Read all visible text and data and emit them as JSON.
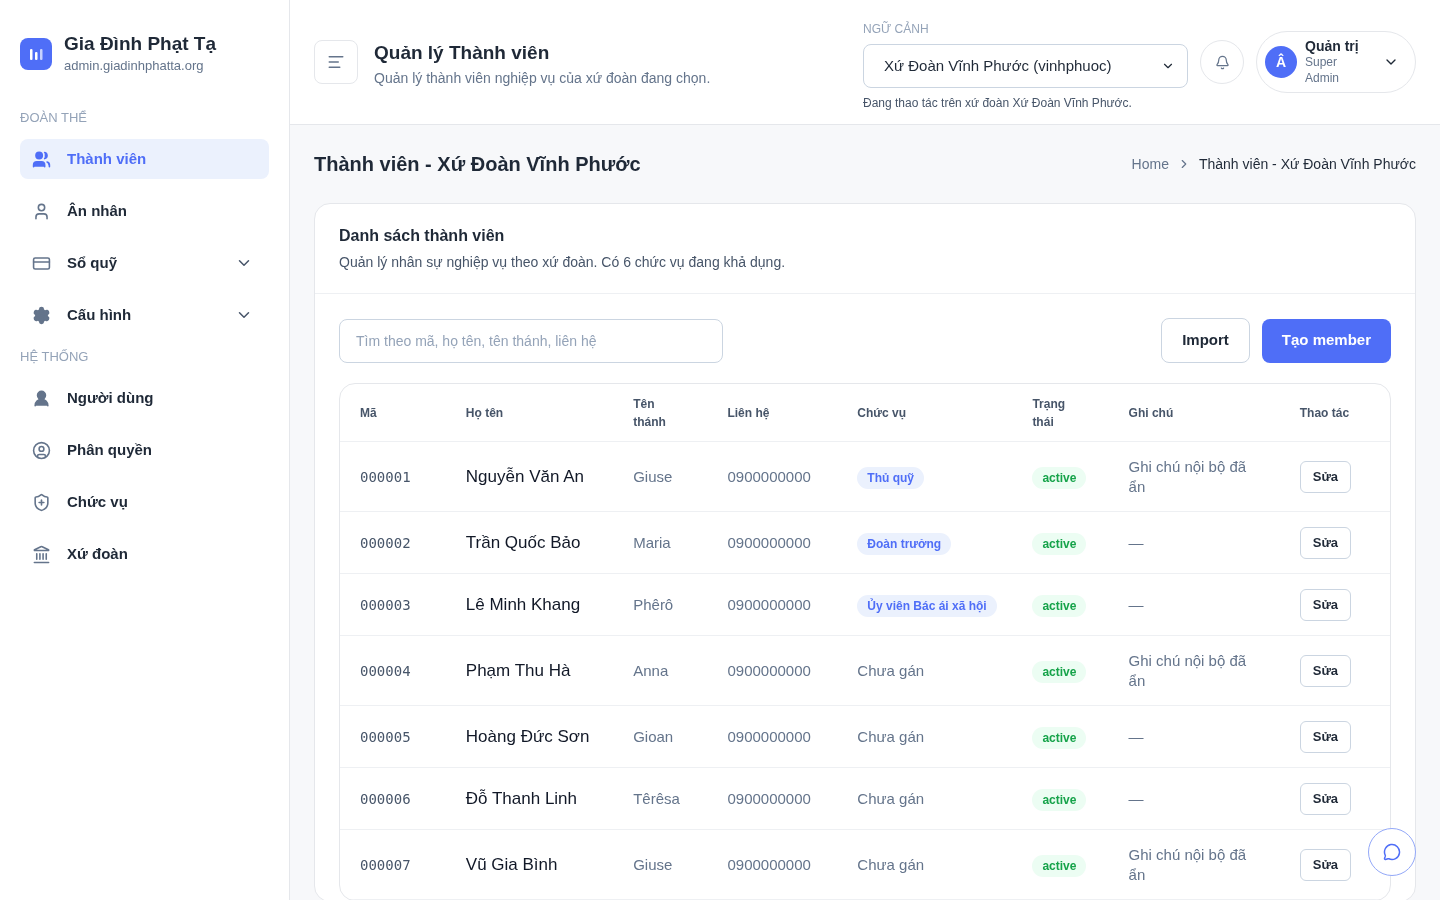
{
  "brand": {
    "name": "Gia Đình Phạt Tạ",
    "domain": "admin.giadinhphatta.org"
  },
  "sidebar": {
    "sections": [
      {
        "title": "ĐOÀN THỂ",
        "items": [
          {
            "label": "Thành viên",
            "selected": true,
            "has_submenu": false
          },
          {
            "label": "Ân nhân",
            "selected": false,
            "has_submenu": false
          },
          {
            "label": "Sổ quỹ",
            "selected": false,
            "has_submenu": true
          },
          {
            "label": "Cấu hình",
            "selected": false,
            "has_submenu": true
          }
        ]
      },
      {
        "title": "HỆ THỐNG",
        "items": [
          {
            "label": "Người dùng",
            "selected": false,
            "has_submenu": false
          },
          {
            "label": "Phân quyền",
            "selected": false,
            "has_submenu": false
          },
          {
            "label": "Chức vụ",
            "selected": false,
            "has_submenu": false
          },
          {
            "label": "Xứ đoàn",
            "selected": false,
            "has_submenu": false
          }
        ]
      }
    ]
  },
  "header": {
    "title": "Quản lý Thành viên",
    "subtitle": "Quản lý thành viên nghiệp vụ của xứ đoàn đang chọn.",
    "context_label": "NGỮ CẢNH",
    "context_value": "Xứ Đoàn Vĩnh Phước (vinhphuoc)",
    "context_hint": "Đang thao tác trên xứ đoàn Xứ Đoàn Vĩnh Phước.",
    "user": {
      "initial": "Â",
      "name": "Quản trị",
      "role": "Super Admin"
    }
  },
  "page": {
    "title": "Thành viên - Xứ Đoàn Vĩnh Phước",
    "breadcrumb": [
      "Home",
      "Thành viên - Xứ Đoàn Vĩnh Phước"
    ]
  },
  "card": {
    "title": "Danh sách thành viên",
    "subtitle": "Quản lý nhân sự nghiệp vụ theo xứ đoàn. Có 6 chức vụ đang khả dụng.",
    "search_placeholder": "Tìm theo mã, họ tên, tên thánh, liên hệ",
    "buttons": [
      "Import",
      "Tạo member"
    ]
  },
  "table": {
    "columns": [
      "Mã",
      "Họ tên",
      "Tên thánh",
      "Liên hệ",
      "Chức vụ",
      "Trạng thái",
      "Ghi chú",
      "Thao tác"
    ],
    "rows": [
      {
        "code": "000001",
        "name": "Nguyễn Văn An",
        "saint": "Giuse",
        "phone": "0900000000",
        "role": {
          "kind": "badge",
          "text": "Thủ quỹ"
        },
        "status": "active",
        "note": "Ghi chú nội bộ đã ẩn",
        "action": "Sửa"
      },
      {
        "code": "000002",
        "name": "Trần Quốc Bảo",
        "saint": "Maria",
        "phone": "0900000000",
        "role": {
          "kind": "badge",
          "text": "Đoàn trưởng"
        },
        "status": "active",
        "note": "—",
        "action": "Sửa"
      },
      {
        "code": "000003",
        "name": "Lê Minh Khang",
        "saint": "Phêrô",
        "phone": "0900000000",
        "role": {
          "kind": "badge",
          "text": "Ủy viên Bác ái xã hội"
        },
        "status": "active",
        "note": "—",
        "action": "Sửa"
      },
      {
        "code": "000004",
        "name": "Phạm Thu Hà",
        "saint": "Anna",
        "phone": "0900000000",
        "role": {
          "kind": "plain",
          "text": "Chưa gán"
        },
        "status": "active",
        "note": "Ghi chú nội bộ đã ẩn",
        "action": "Sửa"
      },
      {
        "code": "000005",
        "name": "Hoàng Đức Sơn",
        "saint": "Gioan",
        "phone": "0900000000",
        "role": {
          "kind": "plain",
          "text": "Chưa gán"
        },
        "status": "active",
        "note": "—",
        "action": "Sửa"
      },
      {
        "code": "000006",
        "name": "Đỗ Thanh Linh",
        "saint": "Têrêsa",
        "phone": "0900000000",
        "role": {
          "kind": "plain",
          "text": "Chưa gán"
        },
        "status": "active",
        "note": "—",
        "action": "Sửa"
      },
      {
        "code": "000007",
        "name": "Vũ Gia Bình",
        "saint": "Giuse",
        "phone": "0900000000",
        "role": {
          "kind": "plain",
          "text": "Chưa gán"
        },
        "status": "active",
        "note": "Ghi chú nội bộ đã ẩn",
        "action": "Sửa"
      }
    ]
  }
}
